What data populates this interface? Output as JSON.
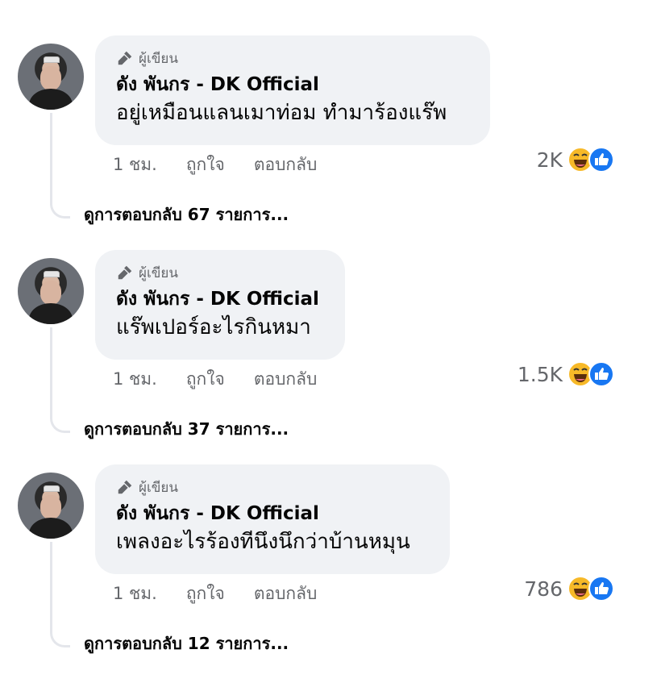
{
  "comments": [
    {
      "badge": "ผู้เขียน",
      "author": "ดัง พันกร - DK Official",
      "text": "อยู่เหมือนแลนเมาท่อม ทำมาร้องแร๊พ",
      "time": "1 ชม.",
      "like_label": "ถูกใจ",
      "reply_label": "ตอบกลับ",
      "reaction_count": "2K",
      "replies_label": "ดูการตอบกลับ 67 รายการ..."
    },
    {
      "badge": "ผู้เขียน",
      "author": "ดัง พันกร - DK Official",
      "text": "แร๊พเปอร์อะไรกินหมา",
      "time": "1 ชม.",
      "like_label": "ถูกใจ",
      "reply_label": "ตอบกลับ",
      "reaction_count": "1.5K",
      "replies_label": "ดูการตอบกลับ 37 รายการ..."
    },
    {
      "badge": "ผู้เขียน",
      "author": "ดัง พันกร - DK Official",
      "text": "เพลงอะไรร้องทีนึงนึกว่าบ้านหมุน",
      "time": "1 ชม.",
      "like_label": "ถูกใจ",
      "reply_label": "ตอบกลับ",
      "reaction_count": "786",
      "replies_label": "ดูการตอบกลับ 12 รายการ..."
    }
  ],
  "icons": {
    "badge": "microphone-icon",
    "reaction_1": "laughing-emoji-icon",
    "reaction_2": "like-thumb-icon"
  },
  "colors": {
    "bubble": "#f0f2f5",
    "secondary_text": "#65676b",
    "like_blue": "#1877f2",
    "haha_yellow": "#f7b928"
  }
}
